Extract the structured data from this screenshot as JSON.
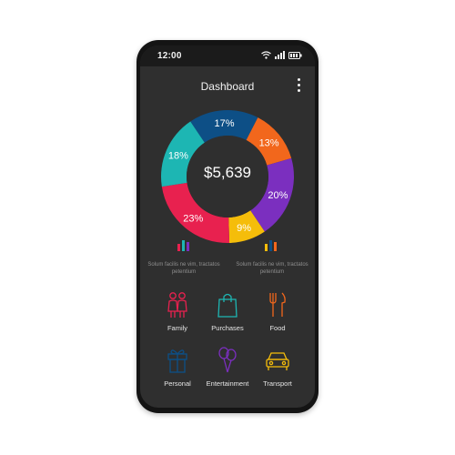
{
  "status_bar": {
    "time": "12:00",
    "icons": [
      "wifi-icon",
      "signal-icon",
      "battery-icon"
    ]
  },
  "header": {
    "title": "Dashboard",
    "menu_icon": "more-vertical-icon"
  },
  "chart_data": {
    "type": "pie",
    "center_label": "$5,639",
    "segments": [
      {
        "label": "17%",
        "value": 17,
        "color": "#0d4f86"
      },
      {
        "label": "13%",
        "value": 13,
        "color": "#f2671c"
      },
      {
        "label": "20%",
        "value": 20,
        "color": "#7b2fbf"
      },
      {
        "label": "9%",
        "value": 9,
        "color": "#f5bd0a"
      },
      {
        "label": "23%",
        "value": 23,
        "color": "#e8214f"
      },
      {
        "label": "18%",
        "value": 18,
        "color": "#1db6b3"
      }
    ]
  },
  "legend": [
    {
      "icon": "bar-chart-icon",
      "text": "Solum facilis ne vim, tractatos petentium",
      "colors": [
        "#e8214f",
        "#1db6b3",
        "#7b2fbf"
      ]
    },
    {
      "icon": "bar-chart-icon",
      "text": "Solum facilis ne vim, tractatos petentium",
      "colors": [
        "#f5bd0a",
        "#0d4f86",
        "#f2671c"
      ]
    }
  ],
  "categories": [
    {
      "label": "Family",
      "icon": "family-icon",
      "color": "#e8214f"
    },
    {
      "label": "Purchases",
      "icon": "shopping-bag-icon",
      "color": "#1db6b3"
    },
    {
      "label": "Food",
      "icon": "utensils-icon",
      "color": "#f2671c"
    },
    {
      "label": "Personal",
      "icon": "gift-icon",
      "color": "#0d4f86"
    },
    {
      "label": "Entertainment",
      "icon": "balloons-icon",
      "color": "#7b2fbf"
    },
    {
      "label": "Transport",
      "icon": "car-icon",
      "color": "#f5bd0a"
    }
  ]
}
